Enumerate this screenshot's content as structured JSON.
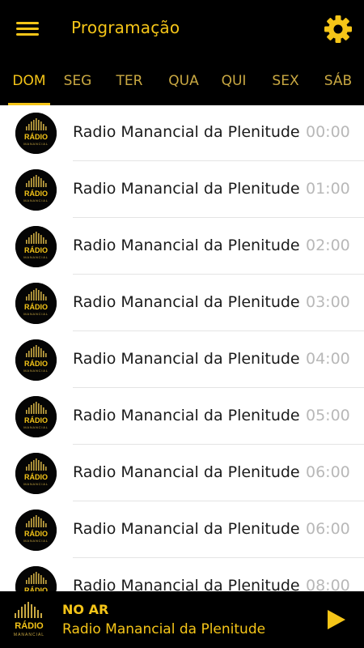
{
  "header": {
    "title": "Programação",
    "menu_icon": "hamburger-menu-icon",
    "settings_icon": "gear-icon"
  },
  "tabs": [
    {
      "label": "DOM",
      "active": true
    },
    {
      "label": "SEG",
      "active": false
    },
    {
      "label": "TER",
      "active": false
    },
    {
      "label": "QUA",
      "active": false
    },
    {
      "label": "QUI",
      "active": false
    },
    {
      "label": "SEX",
      "active": false
    },
    {
      "label": "SÁB",
      "active": false
    }
  ],
  "schedule": [
    {
      "title": "Radio Manancial da Plenitude",
      "time": "00:00"
    },
    {
      "title": "Radio Manancial da Plenitude",
      "time": "01:00"
    },
    {
      "title": "Radio Manancial da Plenitude",
      "time": "02:00"
    },
    {
      "title": "Radio Manancial da Plenitude",
      "time": "03:00"
    },
    {
      "title": "Radio Manancial da Plenitude",
      "time": "04:00"
    },
    {
      "title": "Radio Manancial da Plenitude",
      "time": "05:00"
    },
    {
      "title": "Radio Manancial da Plenitude",
      "time": "06:00"
    },
    {
      "title": "Radio Manancial da Plenitude",
      "time": "06:00"
    },
    {
      "title": "Radio Manancial da Plenitude",
      "time": "08:00"
    }
  ],
  "logo": {
    "text": "RÁDIO",
    "subtext": "MANANCIAL"
  },
  "player": {
    "status": "NO AR",
    "title": "Radio Manancial da Plenitude",
    "play_icon": "play-icon"
  },
  "colors": {
    "accent": "#f5c518",
    "bar": "#000000",
    "time": "#b8b8b8"
  }
}
